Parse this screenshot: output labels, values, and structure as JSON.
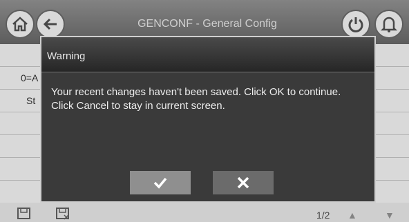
{
  "header": {
    "title": "GENCONF - General Config",
    "home_icon": "home-icon",
    "back_icon": "back-arrow-icon",
    "power_icon": "power-icon",
    "alarm_icon": "bell-icon"
  },
  "background": {
    "rows": [
      "0=A",
      "St"
    ]
  },
  "footer": {
    "save_icon": "save-icon",
    "save_as_icon": "save-discard-icon",
    "page": "1/2",
    "up_icon": "up-arrow-icon",
    "down_icon": "down-arrow-icon"
  },
  "dialog": {
    "title": "Warning",
    "message": "Your recent changes haven't been saved. Click OK to continue. Click Cancel to stay in current screen.",
    "ok_icon": "check-icon",
    "cancel_icon": "close-icon"
  },
  "colors": {
    "header_bg": "#7f7f7f",
    "dialog_bg": "#3a3a3a",
    "dialog_border": "#cfcfcf",
    "ok_button": "#8f8f8f",
    "cancel_button": "#6b6b6b"
  }
}
